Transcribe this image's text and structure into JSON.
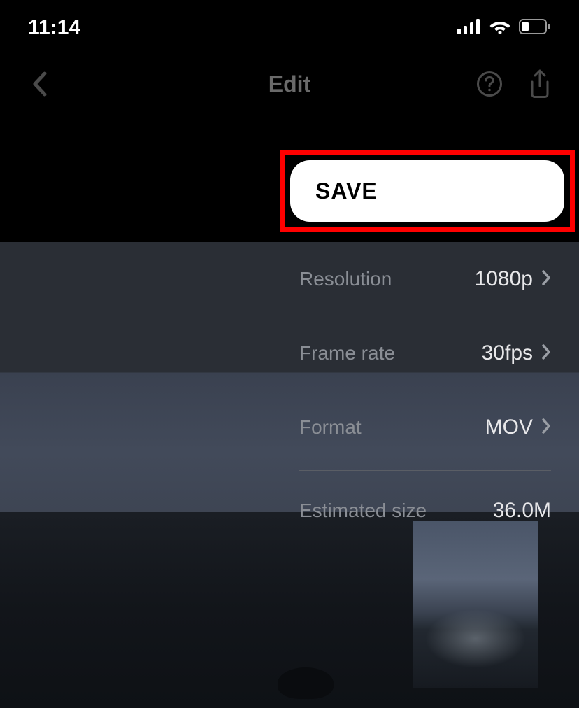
{
  "status": {
    "time": "11:14"
  },
  "header": {
    "title": "Edit"
  },
  "save": {
    "label": "SAVE"
  },
  "settings": {
    "resolution": {
      "label": "Resolution",
      "value": "1080p"
    },
    "frameRate": {
      "label": "Frame rate",
      "value": "30fps"
    },
    "format": {
      "label": "Format",
      "value": "MOV"
    },
    "estimatedSize": {
      "label": "Estimated size",
      "value": "36.0M"
    }
  }
}
